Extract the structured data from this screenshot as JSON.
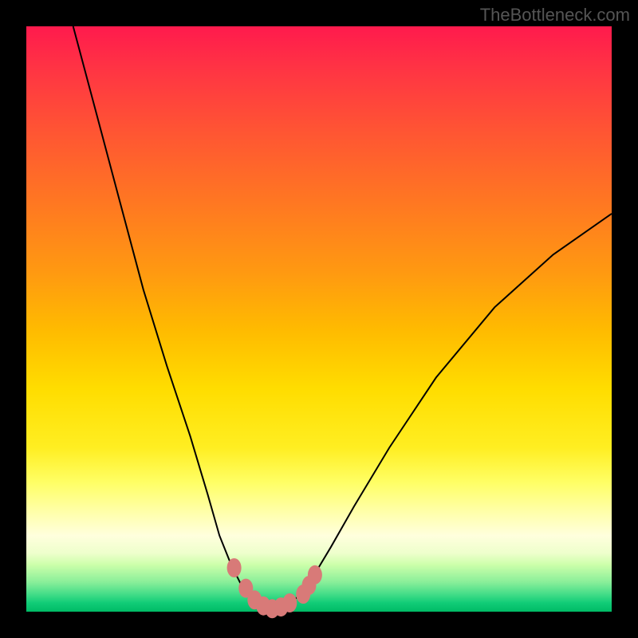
{
  "watermark": "TheBottleneck.com",
  "chart_data": {
    "type": "line",
    "title": "",
    "xlabel": "",
    "ylabel": "",
    "xlim": [
      0,
      100
    ],
    "ylim": [
      0,
      100
    ],
    "background": "gradient-red-orange-yellow-green-vertical",
    "series": [
      {
        "name": "bottleneck-curve",
        "type": "line",
        "color": "#000000",
        "points": [
          {
            "x": 8,
            "y": 100
          },
          {
            "x": 12,
            "y": 85
          },
          {
            "x": 16,
            "y": 70
          },
          {
            "x": 20,
            "y": 55
          },
          {
            "x": 24,
            "y": 42
          },
          {
            "x": 28,
            "y": 30
          },
          {
            "x": 31,
            "y": 20
          },
          {
            "x": 33,
            "y": 13
          },
          {
            "x": 35,
            "y": 8
          },
          {
            "x": 37,
            "y": 4
          },
          {
            "x": 39,
            "y": 1.5
          },
          {
            "x": 41,
            "y": 0.5
          },
          {
            "x": 43,
            "y": 0.5
          },
          {
            "x": 45,
            "y": 1.5
          },
          {
            "x": 47,
            "y": 3
          },
          {
            "x": 49,
            "y": 6
          },
          {
            "x": 52,
            "y": 11
          },
          {
            "x": 56,
            "y": 18
          },
          {
            "x": 62,
            "y": 28
          },
          {
            "x": 70,
            "y": 40
          },
          {
            "x": 80,
            "y": 52
          },
          {
            "x": 90,
            "y": 61
          },
          {
            "x": 100,
            "y": 68
          }
        ]
      },
      {
        "name": "data-markers",
        "type": "scatter",
        "color": "#d87a78",
        "points": [
          {
            "x": 35.5,
            "y": 7.5
          },
          {
            "x": 37.5,
            "y": 4
          },
          {
            "x": 39,
            "y": 2
          },
          {
            "x": 40.5,
            "y": 1
          },
          {
            "x": 42,
            "y": 0.5
          },
          {
            "x": 43.5,
            "y": 0.8
          },
          {
            "x": 45,
            "y": 1.5
          },
          {
            "x": 47.3,
            "y": 3
          },
          {
            "x": 48.3,
            "y": 4.5
          },
          {
            "x": 49.3,
            "y": 6.3
          }
        ]
      }
    ]
  }
}
